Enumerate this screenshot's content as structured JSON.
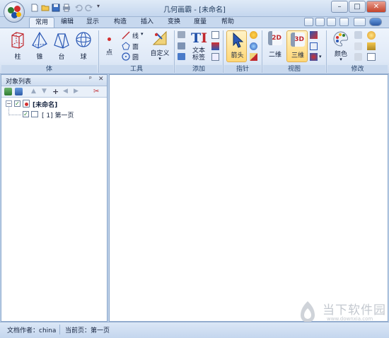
{
  "window": {
    "title": "几何画霸 - [未命名]",
    "controls": {
      "minimize": "–",
      "maximize": "□",
      "close": "✕"
    }
  },
  "ribbon_tabs": [
    "常用",
    "编辑",
    "显示",
    "构造",
    "插入",
    "变换",
    "度量",
    "帮助"
  ],
  "active_tab": "常用",
  "groups": {
    "solid": {
      "label": "体",
      "items": [
        "柱",
        "锥",
        "台",
        "球"
      ]
    },
    "tools": {
      "label": "工具",
      "point": "点",
      "line": "线",
      "face": "面",
      "circle": "圆",
      "custom": "自定义"
    },
    "add": {
      "label": "添加",
      "text_label": "文本\n标签"
    },
    "pointer": {
      "label": "指针",
      "arrow": "箭头"
    },
    "view": {
      "label": "视图",
      "view2d": "二维",
      "view3d": "三维",
      "icon2d": "2D",
      "icon3d": "3D"
    },
    "modify": {
      "label": "修改",
      "color": "颜色"
    }
  },
  "object_panel": {
    "title": "对象列表",
    "pin": "ᵖ",
    "close": "✕",
    "tree": {
      "root": "[未命名]",
      "page": "[ 1] 第一页"
    }
  },
  "status": {
    "author_label": "文档作者：",
    "author": "china",
    "page_label": "当前页：",
    "page": "第一页"
  },
  "watermark": {
    "title": "当下软件园",
    "url": "www.downxia.com"
  },
  "colors": {
    "ribbon_bg": "#dfe9f7",
    "accent_border": "#8ea9cc",
    "highlight": "#ffd775",
    "close_red": "#c4432a"
  },
  "icons": [
    "orb-logo-icon",
    "new-file-icon",
    "open-folder-icon",
    "save-icon",
    "print-icon",
    "undo-icon",
    "redo-icon",
    "prism-icon",
    "pyramid-icon",
    "frustum-icon",
    "sphere-icon",
    "point-icon",
    "line-icon",
    "polygon-icon",
    "circle-icon",
    "custom-ruler-icon",
    "text-icon",
    "arrow-pointer-icon",
    "view-2d-icon",
    "view-3d-icon",
    "palette-icon"
  ]
}
